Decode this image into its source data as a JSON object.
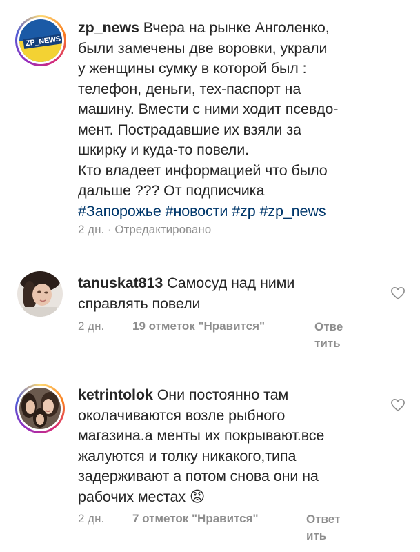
{
  "post": {
    "avatar_text": "ZP_NEWS",
    "username": "zp_news",
    "lines": [
      "Вчера на рынке Анголенко,",
      "были замечены две воровки, украли",
      "у женщины сумку в которой был :",
      "телефон, деньги, тех-паспорт на",
      "машину. Вмести с ними ходит псевдо-",
      "мент. Пострадавшие их взяли за",
      "шкирку и куда-то повели.",
      "Кто владеет информацией что было",
      "дальше ??? От подписчика"
    ],
    "hashtags": [
      "#Запорожье",
      "#новости",
      "#zp",
      "#zp_news"
    ],
    "meta": "2 дн. · Отредактировано"
  },
  "comments": [
    {
      "avatar": "user-photo-tanuskat",
      "username": "tanuskat813",
      "lines": [
        "Самосуд над ними",
        "справлять повели"
      ],
      "time": "2 дн.",
      "likes": "19 отметок \"Нравится\"",
      "reply_lines": [
        "Отве",
        "тить"
      ]
    },
    {
      "avatar": "user-photo-ketrintolok",
      "username": "ketrintolok",
      "lines": [
        "Они постоянно там",
        "околачиваются возле рыбного",
        "магазина.а менты их покрывают.все",
        "жалуются и толку никакого,типа",
        "задерживают а потом снова  они на",
        "рабочих местах"
      ],
      "emoji": "😡",
      "time": "2 дн.",
      "likes": "7 отметок \"Нравится\"",
      "reply_lines": [
        "Ответ",
        "ить"
      ]
    }
  ],
  "colors": {
    "text": "#262626",
    "secondary": "#8e8e8e",
    "hashtag": "#00376b",
    "divider": "#dbdbdb"
  }
}
